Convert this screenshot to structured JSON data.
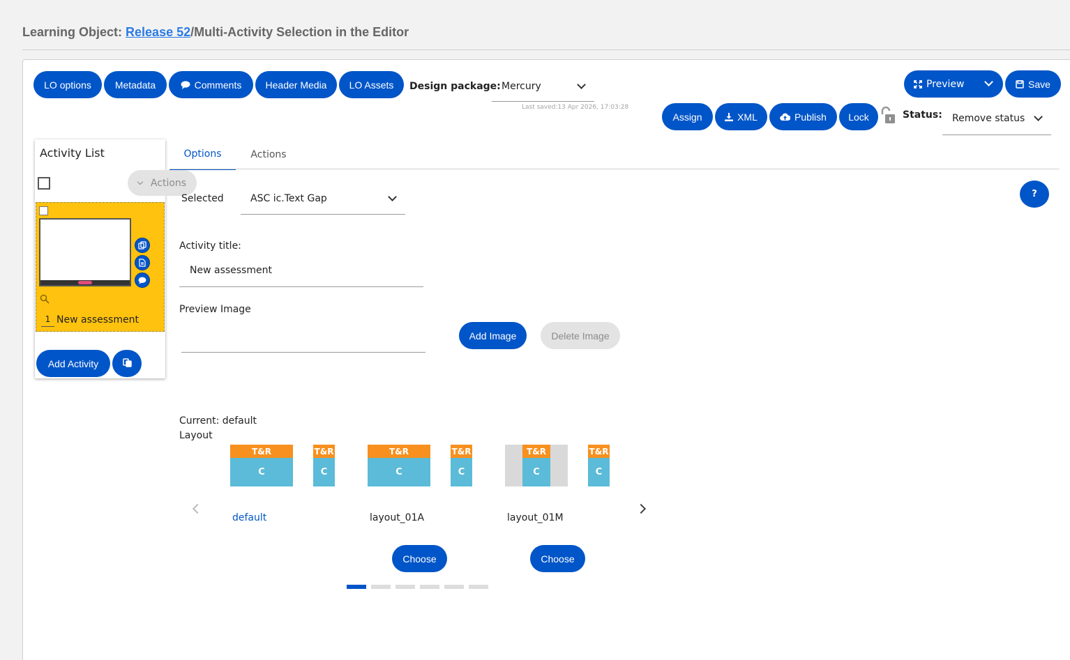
{
  "header": {
    "prefix": "Learning Object: ",
    "link": "Release 52",
    "suffix": "/Multi-Activity Selection in the Editor"
  },
  "toolbar": {
    "lo_options": "LO options",
    "metadata": "Metadata",
    "comments": "Comments",
    "header_media": "Header Media",
    "lo_assets": "LO Assets",
    "design_package_label": "Design package:",
    "design_package_value": "Mercury",
    "last_saved": "Last saved:13 Apr 2026, 17:03:28",
    "preview": "Preview",
    "save": "Save",
    "assign": "Assign",
    "xml": "XML",
    "publish": "Publish",
    "lock": "Lock",
    "status_label": "Status:",
    "status_value": "Remove status"
  },
  "activity_list": {
    "heading": "Activity List",
    "actions": "Actions",
    "items": [
      {
        "number": "1",
        "title": "New assessment"
      }
    ],
    "add_activity": "Add Activity"
  },
  "tabs": [
    {
      "label": "Options",
      "active": true
    },
    {
      "label": "Actions",
      "active": false
    }
  ],
  "options": {
    "selected_label": "Selected",
    "selected_value": "ASC ic.Text Gap",
    "activity_title_label": "Activity title:",
    "activity_title_value": "New assessment",
    "preview_image_label": "Preview Image",
    "add_image": "Add Image",
    "delete_image": "Delete Image",
    "help": "?"
  },
  "layout": {
    "current": "Current: default",
    "label": "Layout",
    "top_tag": "T&R",
    "content_tag": "C",
    "options": [
      {
        "name": "default",
        "selected": true,
        "choose": ""
      },
      {
        "name": "layout_01A",
        "selected": false,
        "choose": "Choose"
      },
      {
        "name": "layout_01M",
        "selected": false,
        "choose": "Choose"
      }
    ],
    "pages": 6,
    "current_page": 1
  },
  "colors": {
    "primary": "#0055c8",
    "highlight": "#ffc20e",
    "tag_orange": "#f7901e",
    "tag_blue": "#5bbbd8"
  }
}
